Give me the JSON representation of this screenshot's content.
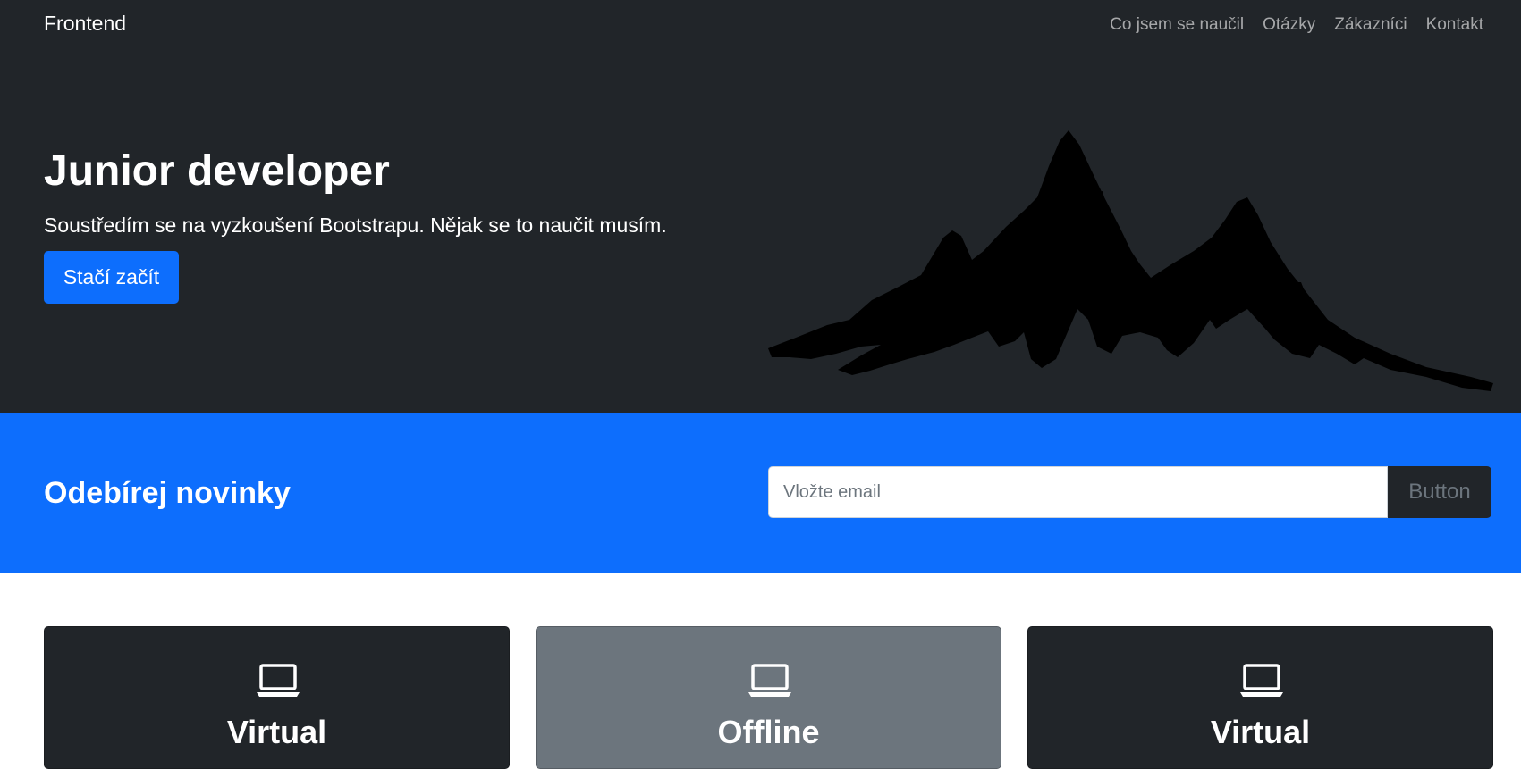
{
  "navbar": {
    "brand": "Frontend",
    "links": [
      {
        "label": "Co jsem se naučil"
      },
      {
        "label": "Otázky"
      },
      {
        "label": "Zákazníci"
      },
      {
        "label": "Kontakt"
      }
    ]
  },
  "hero": {
    "title": "Junior developer",
    "subtitle": "Soustředím se na vyzkoušení Bootstrapu. Nějak se to naučit musím.",
    "cta_label": "Stačí začít",
    "illustration_icon": "mountain-illustration"
  },
  "subscribe": {
    "title": "Odebírej novinky",
    "email_placeholder": "Vložte email",
    "email_value": "",
    "button_label": "Button"
  },
  "cards": [
    {
      "icon": "laptop-icon",
      "title": "Virtual",
      "variant": "dark"
    },
    {
      "icon": "laptop-icon",
      "title": "Offline",
      "variant": "gray"
    },
    {
      "icon": "laptop-icon",
      "title": "Virtual",
      "variant": "dark"
    }
  ],
  "colors": {
    "dark": "#212529",
    "primary": "#0d6efd",
    "secondary": "#6c757d",
    "white": "#ffffff"
  }
}
